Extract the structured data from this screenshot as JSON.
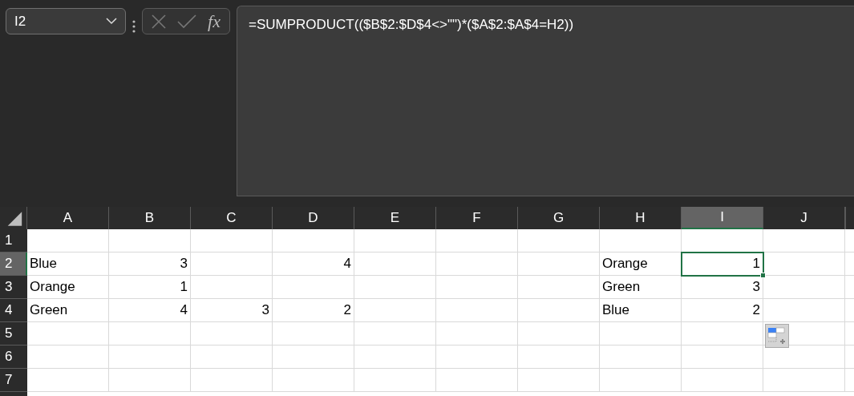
{
  "name_box": {
    "value": "I2"
  },
  "formula_bar": {
    "fx": "fx",
    "formula": "=SUMPRODUCT(($B$2:$D$4<>\"\")*($A$2:$A$4=H2))"
  },
  "columns": [
    {
      "label": "A",
      "selected": false
    },
    {
      "label": "B",
      "selected": false
    },
    {
      "label": "C",
      "selected": false
    },
    {
      "label": "D",
      "selected": false
    },
    {
      "label": "E",
      "selected": false
    },
    {
      "label": "F",
      "selected": false
    },
    {
      "label": "G",
      "selected": false
    },
    {
      "label": "H",
      "selected": false
    },
    {
      "label": "I",
      "selected": true
    },
    {
      "label": "J",
      "selected": false
    }
  ],
  "rows": [
    {
      "label": "1",
      "selected": false,
      "cells": [
        null,
        null,
        null,
        null,
        null,
        null,
        null,
        null,
        null,
        null
      ]
    },
    {
      "label": "2",
      "selected": true,
      "cells": [
        {
          "value": "Blue",
          "kind": "text",
          "active": false
        },
        {
          "value": "3",
          "kind": "number",
          "active": false
        },
        null,
        {
          "value": "4",
          "kind": "number",
          "active": false
        },
        null,
        null,
        null,
        {
          "value": "Orange",
          "kind": "text",
          "active": false
        },
        {
          "value": "1",
          "kind": "number",
          "active": true
        },
        null
      ]
    },
    {
      "label": "3",
      "selected": false,
      "cells": [
        {
          "value": "Orange",
          "kind": "text",
          "active": false
        },
        {
          "value": "1",
          "kind": "number",
          "active": false
        },
        null,
        null,
        null,
        null,
        null,
        {
          "value": "Green",
          "kind": "text",
          "active": false
        },
        {
          "value": "3",
          "kind": "number",
          "active": false
        },
        null
      ]
    },
    {
      "label": "4",
      "selected": false,
      "cells": [
        {
          "value": "Green",
          "kind": "text",
          "active": false
        },
        {
          "value": "4",
          "kind": "number",
          "active": false
        },
        {
          "value": "3",
          "kind": "number",
          "active": false
        },
        {
          "value": "2",
          "kind": "number",
          "active": false
        },
        null,
        null,
        null,
        {
          "value": "Blue",
          "kind": "text",
          "active": false
        },
        {
          "value": "2",
          "kind": "number",
          "active": false
        },
        null
      ]
    },
    {
      "label": "5",
      "selected": false,
      "cells": [
        null,
        null,
        null,
        null,
        null,
        null,
        null,
        null,
        null,
        null
      ]
    },
    {
      "label": "6",
      "selected": false,
      "cells": [
        null,
        null,
        null,
        null,
        null,
        null,
        null,
        null,
        null,
        null
      ]
    },
    {
      "label": "7",
      "selected": false,
      "cells": [
        null,
        null,
        null,
        null,
        null,
        null,
        null,
        null,
        null,
        null
      ]
    }
  ]
}
